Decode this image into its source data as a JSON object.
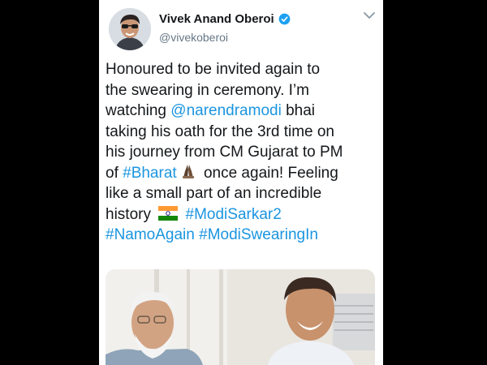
{
  "tweet": {
    "author": {
      "display_name": "Vivek Anand Oberoi",
      "handle": "@vivekoberoi",
      "verified": true,
      "avatar_icon": "profile-photo"
    },
    "menu_icon": "chevron-down-icon",
    "lines": [
      [
        {
          "text": "Honoured to be invited again to"
        }
      ],
      [
        {
          "text": "the swearing in ceremony. I’m"
        }
      ],
      [
        {
          "text": "watching "
        },
        {
          "text": "@narendramodi",
          "link": true
        },
        {
          "text": " bhai"
        }
      ],
      [
        {
          "text": "taking his oath for the 3rd time on"
        }
      ],
      [
        {
          "text": "his journey from CM Gujarat to PM"
        }
      ],
      [
        {
          "text": "of "
        },
        {
          "text": "#Bharat",
          "link": true
        },
        {
          "emoji": "praying-hands-emoji"
        },
        {
          "text": " once again! Feeling"
        }
      ],
      [
        {
          "text": "like a small part of an incredible"
        }
      ],
      [
        {
          "text": "history "
        },
        {
          "emoji": "india-flag-emoji"
        },
        {
          "text": " "
        },
        {
          "text": "#ModiSarkar2",
          "link": true
        }
      ],
      [
        {
          "text": "#NamoAgain",
          "link": true
        },
        {
          "text": " "
        },
        {
          "text": "#ModiSwearingIn",
          "link": true
        }
      ]
    ],
    "media": {
      "type": "photo"
    }
  },
  "colors": {
    "background": "#000000",
    "card": "#ffffff",
    "text": "#14171a",
    "link": "#1b95e0",
    "secondary": "#657786",
    "verified": "#1da1f2"
  }
}
